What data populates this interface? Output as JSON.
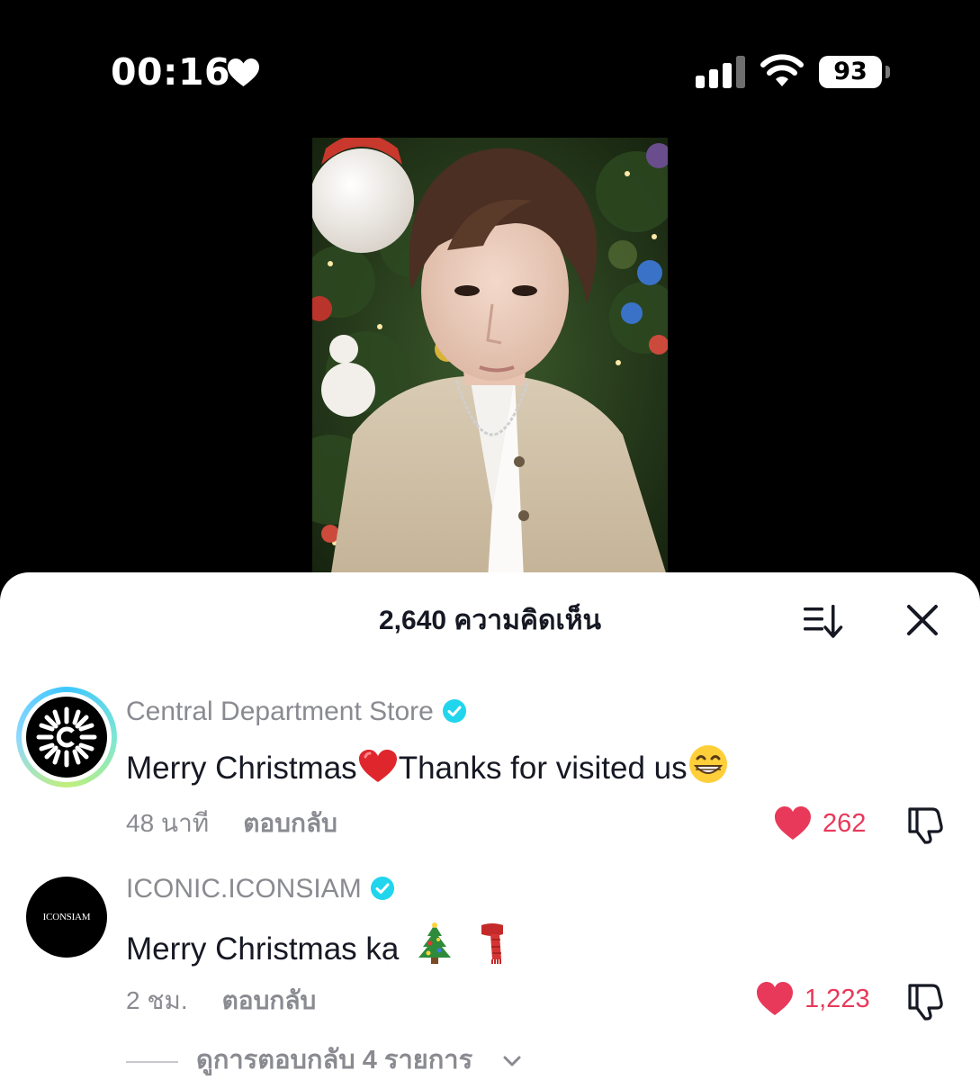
{
  "status_bar": {
    "time": "00:16",
    "battery": "93",
    "icons": [
      "heart-icon",
      "signal-icon",
      "wifi-icon",
      "battery-icon"
    ]
  },
  "video": {
    "icons": [
      "video-frame"
    ]
  },
  "comments_sheet": {
    "title": "2,640 ความคิดเห็น",
    "icons": [
      "sort-icon",
      "close-icon"
    ]
  },
  "comments": [
    {
      "username": "Central Department Store",
      "verified": true,
      "text_before_emoji": "Merry Christmas",
      "text_after_emoji": "Thanks for visited us",
      "emojis": [
        "red-heart-emoji",
        "grinning-face-emoji"
      ],
      "time": "48 นาที",
      "reply_label": "ตอบกลับ",
      "likes": "262"
    },
    {
      "username": "ICONIC.ICONSIAM",
      "verified": true,
      "avatar_text": "ICONSIAM",
      "text": "Merry Christmas ka",
      "emojis": [
        "christmas-tree-emoji",
        "scarf-emoji"
      ],
      "time": "2 ชม.",
      "reply_label": "ตอบกลับ",
      "likes": "1,223",
      "view_replies": "ดูการตอบกลับ 4 รายการ"
    }
  ],
  "colors": {
    "like_red": "#e8395a",
    "verified_blue": "#20d5ec",
    "muted_text": "#8a8b91",
    "primary_text": "#161823"
  }
}
